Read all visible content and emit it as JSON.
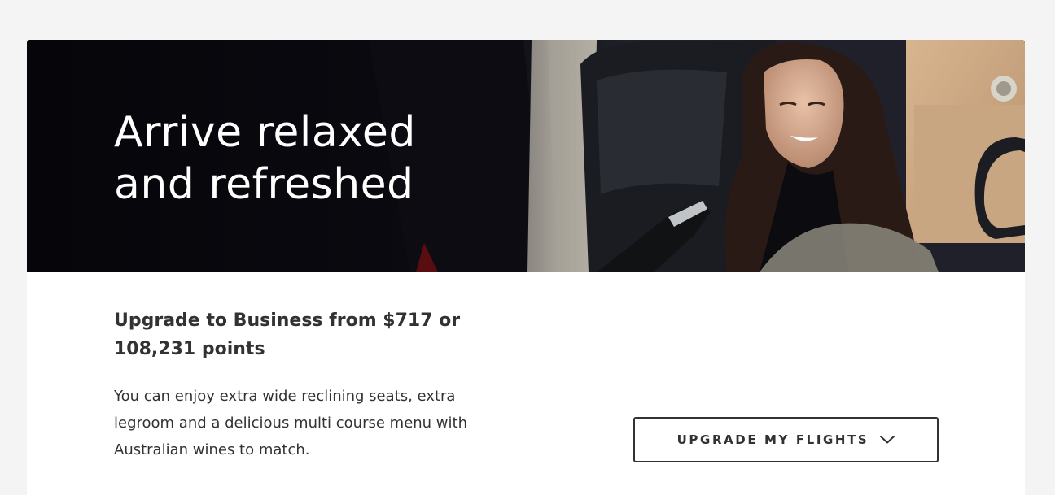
{
  "hero": {
    "title": "Arrive relaxed and refreshed",
    "image_alt": "Smiling passenger in a business class seat being offered wine"
  },
  "offer": {
    "title": "Upgrade to Business from $717 or 108,231 points",
    "description": "You can enjoy extra wide reclining seats, extra legroom and a delicious multi course menu with Australian wines to match."
  },
  "cta": {
    "label": "UPGRADE MY FLIGHTS",
    "icon": "chevron-down-icon"
  },
  "colors": {
    "page_background": "#f4f4f4",
    "card_background": "#ffffff",
    "text": "#323232",
    "hero_dark": "#06060a"
  }
}
